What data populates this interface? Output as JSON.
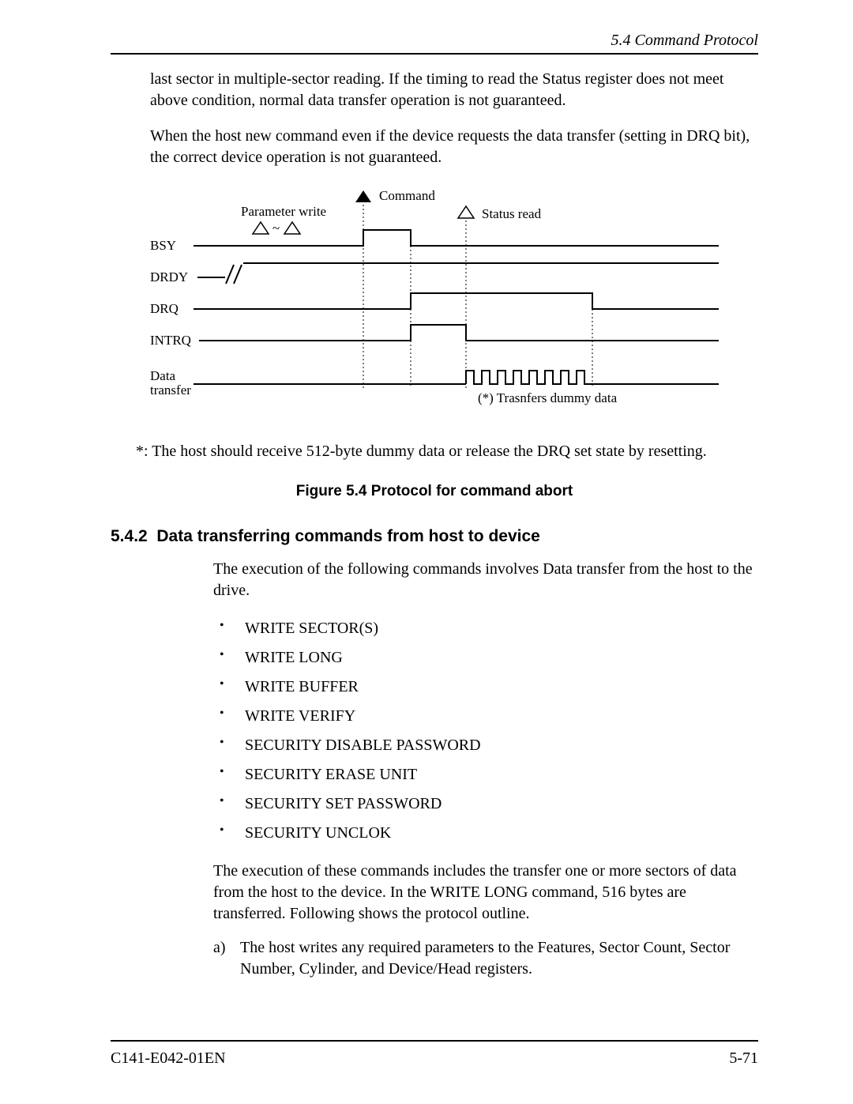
{
  "header": {
    "section": "5.4  Command Protocol"
  },
  "paragraphs": {
    "p1": "last sector in multiple-sector reading.  If the timing to read the Status register does not meet above condition, normal data transfer operation is not guaranteed.",
    "p2": "When the host new command even if the device requests the data transfer (setting in DRQ bit), the correct device operation is not guaranteed."
  },
  "diagram": {
    "labels": {
      "command": "Command",
      "param_write": "Parameter write",
      "status_read": "Status read",
      "bsy": "BSY",
      "drdy": "DRDY",
      "drq": "DRQ",
      "intrq": "INTRQ",
      "data_transfer_1": "Data",
      "data_transfer_2": "transfer",
      "dummy_note": "(*)  Trasnfers dummy data"
    }
  },
  "footnote": "*: The host should receive 512-byte dummy data or release the DRQ set state by resetting.",
  "figure_caption": "Figure 5.4  Protocol for command abort",
  "subsection": {
    "number": "5.4.2",
    "title": "Data transferring commands from host to device"
  },
  "section_body": {
    "intro": "The execution of the following commands involves Data transfer from the host to the drive.",
    "list": [
      "WRITE SECTOR(S)",
      "WRITE LONG",
      "WRITE BUFFER",
      "WRITE VERIFY",
      "SECURITY DISABLE PASSWORD",
      "SECURITY ERASE UNIT",
      "SECURITY SET PASSWORD",
      "SECURITY UNCLOK"
    ],
    "after_list": "The execution of these commands includes the transfer one or more sectors of data from the host to the device.  In the WRITE LONG command, 516 bytes are transferred.  Following shows the protocol outline.",
    "step_a_marker": "a)",
    "step_a": "The host writes any required parameters to the Features, Sector Count, Sector Number, Cylinder, and Device/Head registers."
  },
  "footer": {
    "doc_id": "C141-E042-01EN",
    "page": "5-71"
  }
}
